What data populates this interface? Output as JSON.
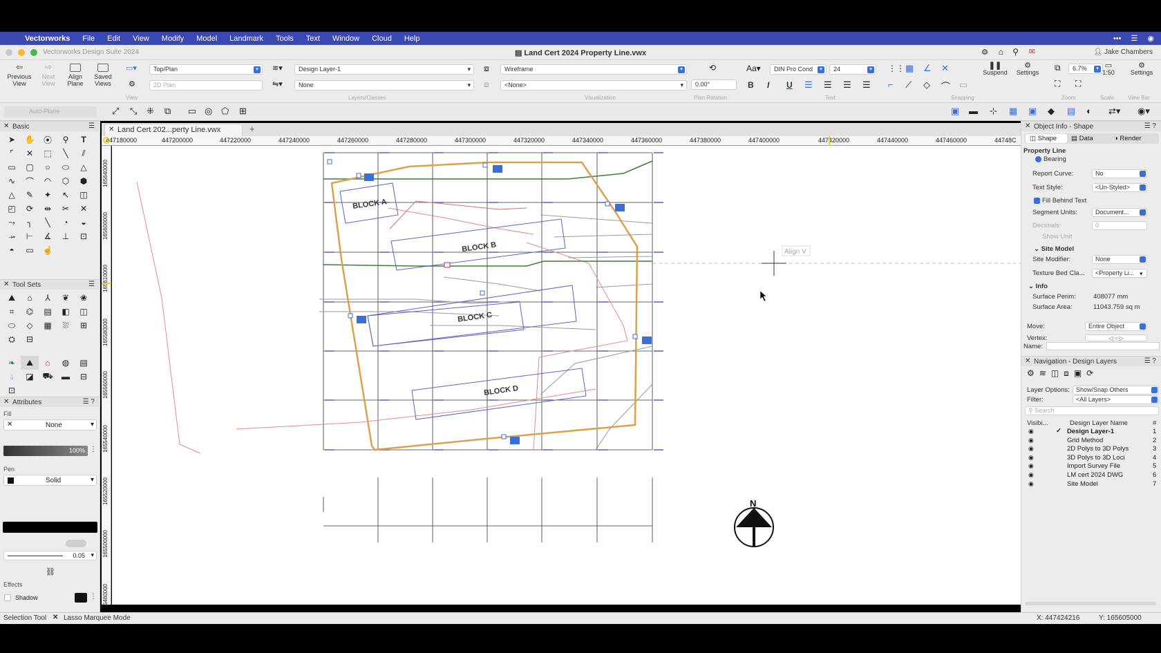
{
  "menubar": {
    "apple": "",
    "app": "Vectorworks",
    "items": [
      "File",
      "Edit",
      "View",
      "Modify",
      "Model",
      "Landmark",
      "Tools",
      "Text",
      "Window",
      "Cloud",
      "Help"
    ],
    "right": [
      "•••",
      "☰",
      "◉"
    ]
  },
  "window": {
    "app_title": "Vectorworks Design Suite 2024",
    "doc_title": "Land Cert 2024 Property Line.vwx",
    "user": "Jake Chambers"
  },
  "toolbar": {
    "previous_view": "Previous View",
    "next_view": "Next View",
    "align_plane": "Align Plane",
    "saved_views": "Saved Views",
    "view_dd": "Top/Plan",
    "render_mode_dd": "2D Plan",
    "layer_dd": "Design Layer-1",
    "class_dd": "None",
    "render_dd": "Wireframe",
    "none_dd": "<None>",
    "rotation": "0.00°",
    "font_dd": "DIN Pro Cond",
    "size_dd": "24",
    "zoom": "6.7%",
    "scale": "1:50",
    "suspend": "Suspend",
    "settings": "Settings",
    "settings2": "Settings",
    "groups": {
      "view": "View",
      "layers": "Layers/Classes",
      "vis": "Visualization",
      "plan_rot": "Plan Rotation",
      "text": "Text",
      "snapping": "Snapping",
      "zoom": "Zoom",
      "scale": "Scale",
      "viewbar": "View Bar"
    },
    "text_format": [
      "B",
      "I",
      "U"
    ]
  },
  "subbar": {
    "auto_plane": "Auto-Plane"
  },
  "left": {
    "basic": "Basic",
    "toolsets": "Tool Sets",
    "attributes": "Attributes",
    "fill_label": "Fill",
    "fill_value": "None",
    "opacity": "100%",
    "pen_label": "Pen",
    "pen_value": "Solid",
    "line_weight": "0.05",
    "effects": "Effects",
    "shadow": "Shadow"
  },
  "doc_tab": "Land Cert 202...perty Line.vwx",
  "rulers": {
    "h": [
      "447180000",
      "447200000",
      "447220000",
      "447240000",
      "447260000",
      "447280000",
      "447300000",
      "447320000",
      "447340000",
      "447360000",
      "447380000",
      "447400000",
      "447420000",
      "447440000",
      "447460000",
      "44748C"
    ],
    "v": [
      "165640000",
      "165600000",
      "165610000",
      "165580000",
      "165560000",
      "165540000",
      "165520000",
      "165500000",
      "5480000"
    ]
  },
  "drawing": {
    "blocks": [
      "BLOCK A",
      "BLOCK B",
      "BLOCK C",
      "BLOCK D"
    ],
    "align_hint": "Align V",
    "north": "N",
    "colors": {
      "property": "#d9a24a",
      "green": "#3f7a3a",
      "pink": "#e08a8a",
      "block": "#5a62c4",
      "grid": "#333333"
    }
  },
  "oip": {
    "title": "Object Info - Shape",
    "tabs": [
      "Shape",
      "Data",
      "Render"
    ],
    "object": "Property Line",
    "bearing": "Bearing",
    "report_curve_label": "Report Curve:",
    "report_curve": "No",
    "text_style_label": "Text Style:",
    "text_style": "<Un-Styled>",
    "fill_behind": "Fill Behind Text",
    "segment_units_label": "Segment Units:",
    "segment_units": "Document...",
    "decimals_label": "Decimals:",
    "decimals": "0",
    "show_unit": "Show Unit",
    "site_model": "Site Model",
    "site_modifier_label": "Site Modifier:",
    "site_modifier": "None",
    "texture_label": "Texture Bed Cla...",
    "texture": "<Property Li...",
    "info": "Info",
    "perim_label": "Surface Perim:",
    "perim": "408077 mm",
    "area_label": "Surface Area:",
    "area": "11043.759  sq m",
    "move_label": "Move:",
    "move": "Entire Object",
    "vertex_label": "Vertex:",
    "name_label": "Name:"
  },
  "nav": {
    "title": "Navigation - Design Layers",
    "layer_options_label": "Layer Options:",
    "layer_options": "Show/Snap Others",
    "filter_label": "Filter:",
    "filter": "<All Layers>",
    "search": "Search",
    "col_visible": "Visibi...",
    "col_name": "Design Layer Name",
    "col_num": "#",
    "layers": [
      {
        "name": "Design Layer-1",
        "num": "1"
      },
      {
        "name": "Grid Method",
        "num": "2"
      },
      {
        "name": "2D Polys to 3D Polys",
        "num": "3"
      },
      {
        "name": "3D Polys to 3D Loci",
        "num": "4"
      },
      {
        "name": "Import Survey File",
        "num": "5"
      },
      {
        "name": "LM cert 2024 DWG",
        "num": "6"
      },
      {
        "name": "Site Model",
        "num": "7"
      }
    ]
  },
  "status": {
    "tool": "Selection Tool",
    "mode": "Lasso Marquee Mode",
    "x": "X: 447424216",
    "y": "Y: 165605000"
  }
}
